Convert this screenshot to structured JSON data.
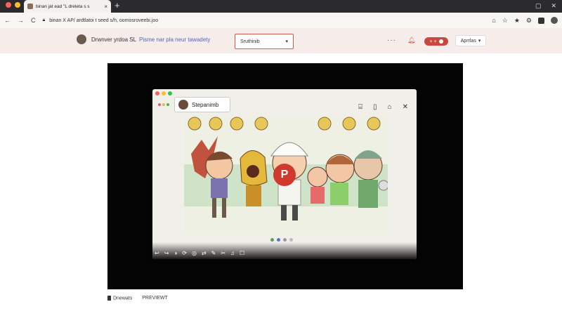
{
  "browser": {
    "tab_title": "binan jat ead \"L dreleta s s",
    "tab_close": "×",
    "new_tab": "+",
    "address": "binan X AP/ ardtlatoi t seed s/h, oomosroveebi.joo",
    "win_controls": [
      "▢",
      "✕"
    ],
    "nav_icons": [
      "←",
      "→",
      "C"
    ],
    "toolbar_icons": [
      "⌂",
      "☆",
      "★",
      "⚙"
    ]
  },
  "header": {
    "site_name": "Drwnver yrdoa",
    "site_short": "SL",
    "tagline": "Pisme nar pla neur tawadety",
    "select_value": "Sruthinib",
    "select_arrow": "▾",
    "more": "···",
    "pill_text": "+ +",
    "account_label": "Aprrlas",
    "account_arrow": "▾"
  },
  "popup": {
    "title": "Stepanimb",
    "play_letter": "P",
    "header_icons": [
      "⌸",
      "▯",
      "⌂",
      "✕"
    ],
    "control_icons": [
      "↩",
      "↪",
      "◑",
      "⟳",
      "◎",
      "⇄",
      "✎",
      "✂",
      "♫",
      "☐"
    ]
  },
  "footer": {
    "item_1": "Dnewats",
    "item_2": "PREVIEWT"
  },
  "colors": {
    "accent": "#c9483e",
    "header_bg": "#f6ece9",
    "link": "#5166b8"
  }
}
